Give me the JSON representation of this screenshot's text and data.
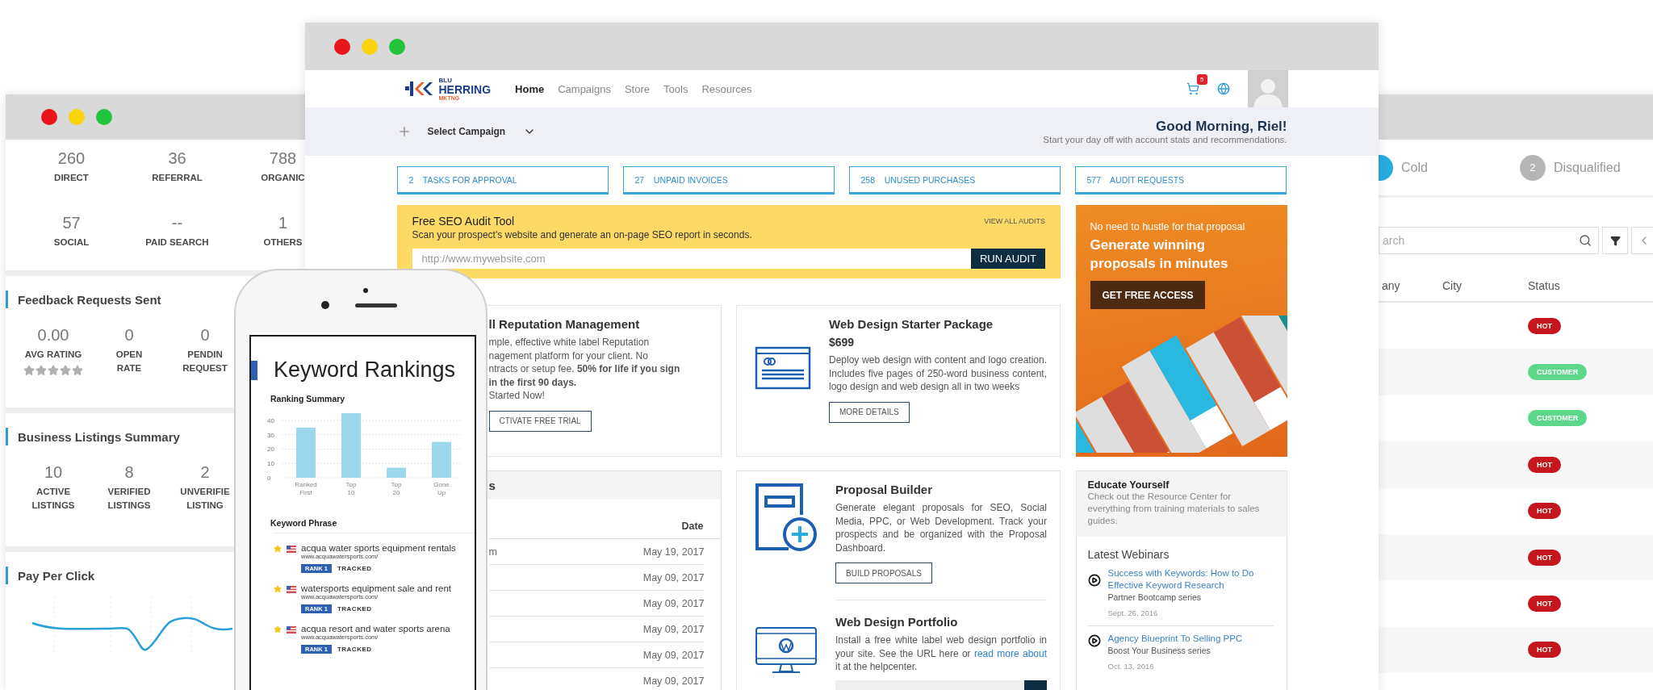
{
  "left_window": {
    "traffic": [
      {
        "value": "260",
        "label": "DIRECT"
      },
      {
        "value": "36",
        "label": "REFERRAL"
      },
      {
        "value": "788",
        "label": "ORGANIC"
      },
      {
        "value": "57",
        "label": "SOCIAL"
      },
      {
        "value": "--",
        "label": "PAID SEARCH"
      },
      {
        "value": "1",
        "label": "OTHERS"
      }
    ],
    "feedback": {
      "title": "Feedback Requests Sent",
      "stats": [
        {
          "value": "0.00",
          "lines": [
            "AVG RATING"
          ],
          "stars": 0
        },
        {
          "value": "0",
          "lines": [
            "OPEN",
            "RATE"
          ]
        },
        {
          "value": "0",
          "lines": [
            "PENDIN",
            "REQUEST"
          ]
        }
      ]
    },
    "listings": {
      "title": "Business Listings Summary",
      "stats": [
        {
          "value": "10",
          "lines": [
            "ACTIVE",
            "LISTINGS"
          ]
        },
        {
          "value": "8",
          "lines": [
            "VERIFIED",
            "LISTINGS"
          ]
        },
        {
          "value": "2",
          "lines": [
            "UNVERIFIE",
            "LISTING"
          ]
        }
      ]
    },
    "ppc": {
      "title": "Pay Per Click"
    }
  },
  "main_window": {
    "logo": {
      "prefix": "BLU",
      "name": "HERRING",
      "suffix": "MKTNG"
    },
    "nav": [
      {
        "label": "Home",
        "selected": true
      },
      {
        "label": "Campaigns",
        "selected": false
      },
      {
        "label": "Store",
        "selected": false
      },
      {
        "label": "Tools",
        "selected": false
      },
      {
        "label": "Resources",
        "selected": false
      }
    ],
    "cart_count": "5",
    "campaign_select": "Select Campaign",
    "greeting": "Good Morning, Riel!",
    "greeting_sub": "Start your day off with account stats and recommendations.",
    "stat_buttons": [
      {
        "count": "2",
        "label": "TASKS FOR APPROVAL"
      },
      {
        "count": "27",
        "label": "UNPAID INVOICES"
      },
      {
        "count": "258",
        "label": "UNUSED PURCHASES"
      },
      {
        "count": "577",
        "label": "AUDIT REQUESTS"
      }
    ],
    "seo_audit": {
      "title": "Free SEO Audit Tool",
      "link": "VIEW ALL AUDITS",
      "subtitle": "Scan your prospect's website and generate an on-page SEO report in seconds.",
      "placeholder": "http://www.mywebsite.com",
      "button": "RUN AUDIT"
    },
    "promo": {
      "kicker": "No need to hustle for that proposal",
      "headline": "Generate winning proposals in minutes",
      "button": "GET FREE ACCESS"
    },
    "reputation_card": {
      "title": "ll Reputation Management",
      "body": "mple, effective white label Reputation\nnagement platform for your client. No\nntracts or setup fee. **50% for life if you sign**\n**in the first 90 days.**\nStarted Now!",
      "button": "CTIVATE FREE TRIAL"
    },
    "starter_card": {
      "title": "Web Design Starter Package",
      "price": "$699",
      "body": "Deploy web design with content and logo creation. Includes five pages of 250-word business content, logo design and web design all in two weeks",
      "button": "MORE DETAILS"
    },
    "activity_card": {
      "title": "s",
      "date_header": "Date",
      "rows": [
        {
          "name": "m",
          "date": "May 19, 2017"
        },
        {
          "date": "May 09, 2017"
        },
        {
          "date": "May 09, 2017"
        },
        {
          "date": "May 09, 2017"
        },
        {
          "date": "May 09, 2017"
        },
        {
          "date": "May 09, 2017"
        }
      ]
    },
    "proposal_card": {
      "title": "Proposal Builder",
      "body": "Generate elegant proposals for SEO, Social Media, PPC, or Web Development. Track your prospects and be organized with the Proposal Dashboard.",
      "button": "BUILD PROPOSALS"
    },
    "portfolio": {
      "title": "Web Design Portfolio",
      "body_before": "Install a free white label web design portfolio in your site. See the URL here or",
      "link": "read more about",
      "body_after": "it at the helpcenter."
    },
    "educate": {
      "title": "Educate Yourself",
      "body": "Check out the Resource Center for everything from training materials to sales guides.",
      "webinars_title": "Latest Webinars",
      "webinars": [
        {
          "title": "Success with Keywords: How to Do Effective Keyword Research",
          "series": "Partner Bootcamp series",
          "date": "Sept. 26, 2016"
        },
        {
          "title": "Agency Blueprint To Selling PPC",
          "series": "Boost Your Business series",
          "date": "Oct. 13, 2016"
        }
      ]
    }
  },
  "right_window": {
    "stages": [
      {
        "label": "Cold",
        "color": "#29abe2"
      },
      {
        "count": "2",
        "label": "Disqualified",
        "color": "#b5b5b5"
      }
    ],
    "search_placeholder": "arch",
    "columns": [
      "any",
      "City",
      "Status"
    ],
    "rows": [
      {
        "status": "HOT",
        "color": "#c4161c"
      },
      {
        "status": "CUSTOMER",
        "color": "#5dd88a"
      },
      {
        "status": "CUSTOMER",
        "color": "#5dd88a"
      },
      {
        "status": "HOT",
        "color": "#c4161c"
      },
      {
        "status": "HOT",
        "color": "#c4161c"
      },
      {
        "status": "HOT",
        "color": "#c4161c"
      },
      {
        "status": "HOT",
        "color": "#c4161c"
      },
      {
        "status": "HOT",
        "color": "#c4161c"
      }
    ]
  },
  "phone": {
    "title": "Keyword Rankings",
    "summary_title": "Ranking Summary",
    "chart_data": {
      "type": "bar",
      "categories": [
        "Ranked First",
        "Top 10",
        "Top 20",
        "Gone Up"
      ],
      "values": [
        35,
        45,
        7,
        25
      ],
      "ylim": [
        0,
        45
      ],
      "yticks": [
        0,
        10,
        20,
        30,
        40
      ],
      "grid": true
    },
    "phrase_title": "Keyword Phrase",
    "keywords": [
      {
        "phrase": "acqua water sports equipment rentals",
        "url": "www.acquawatersports.com/",
        "rank": "RANK 1",
        "tracking": "TRACKED"
      },
      {
        "phrase": "watersports equipment sale and rent",
        "url": "www.acquawatersports.com/",
        "rank": "RANK 1",
        "tracking": "TRACKED"
      },
      {
        "phrase": "acqua resort and water sports arena",
        "url": "www.acquawatersports.com/",
        "rank": "RANK 1",
        "tracking": "TRACKED"
      }
    ]
  }
}
